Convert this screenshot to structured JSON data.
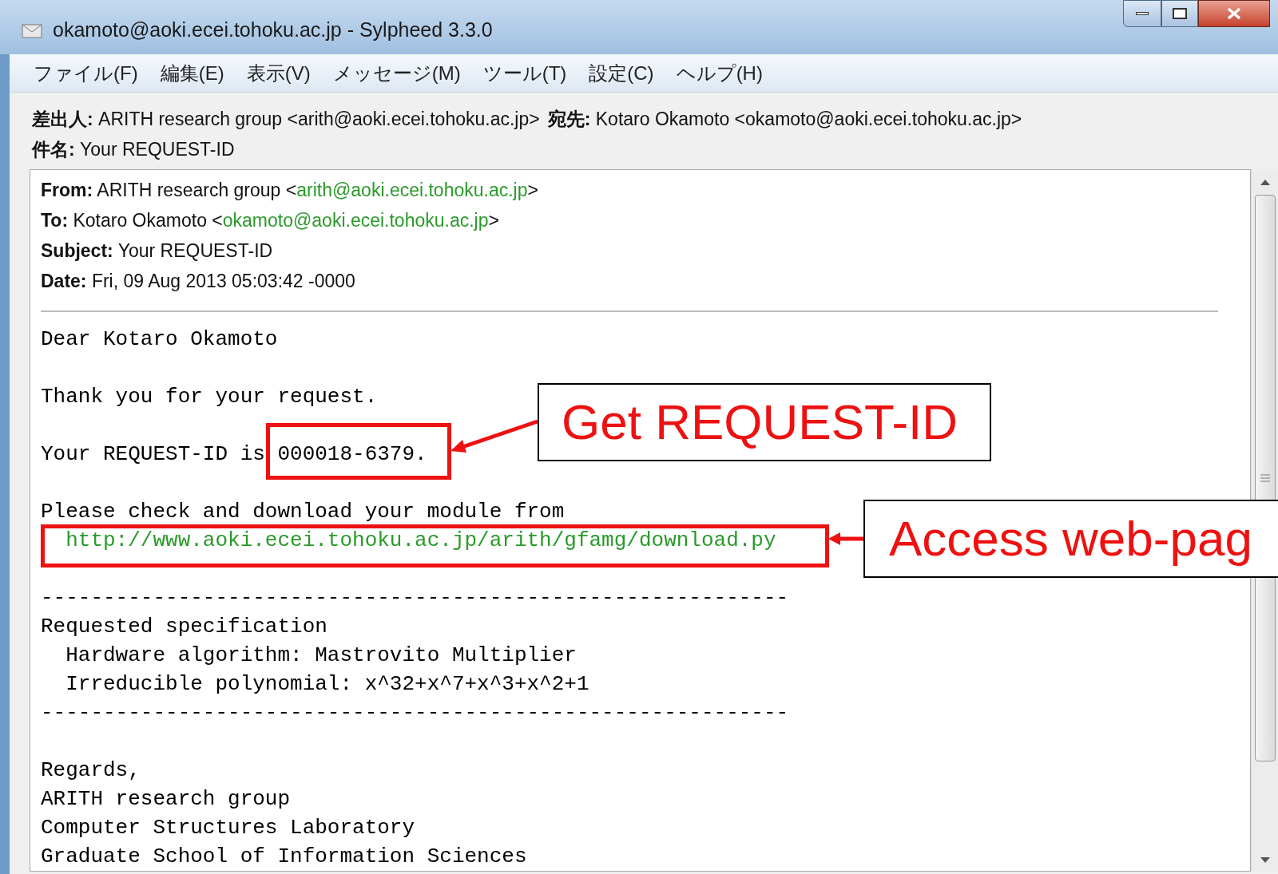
{
  "window": {
    "title": "okamoto@aoki.ecei.tohoku.ac.jp - Sylpheed 3.3.0"
  },
  "menu": [
    "ファイル(F)",
    "編集(E)",
    "表示(V)",
    "メッセージ(M)",
    "ツール(T)",
    "設定(C)",
    "ヘルプ(H)"
  ],
  "summary_header": [
    [
      {
        "label": "差出人:",
        "value": "ARITH research group <arith@aoki.ecei.tohoku.ac.jp>"
      },
      {
        "label": "宛先:",
        "value": "Kotaro Okamoto <okamoto@aoki.ecei.tohoku.ac.jp>"
      }
    ],
    [
      {
        "label": "件名:",
        "value": "Your REQUEST-ID"
      }
    ]
  ],
  "message_header": [
    {
      "label": "From:",
      "value": "ARITH research group <",
      "link": "arith@aoki.ecei.tohoku.ac.jp",
      "after": ">"
    },
    {
      "label": "To:",
      "value": "Kotaro Okamoto <",
      "link": "okamoto@aoki.ecei.tohoku.ac.jp",
      "after": ">"
    },
    {
      "label": "Subject:",
      "value": "Your REQUEST-ID"
    },
    {
      "label": "Date:",
      "value": "Fri, 09 Aug 2013 05:03:42 -0000"
    }
  ],
  "body": [
    [
      {
        "text": "Dear Kotaro Okamoto"
      }
    ],
    [
      {
        "text": "Thank you for your request."
      }
    ],
    [
      {
        "text": "Your REQUEST-ID is 000018-6379."
      }
    ],
    [
      {
        "text": "Please check and download your module from"
      },
      {
        "text": "  http://www.aoki.ecei.tohoku.ac.jp/arith/gfamg/download.py",
        "kind": "link"
      }
    ],
    [
      {
        "text": "------------------------------------------------------------"
      },
      {
        "text": "Requested specification"
      },
      {
        "text": "  Hardware algorithm: Mastrovito Multiplier"
      },
      {
        "text": "  Irreducible polynomial: x^32+x^7+x^3+x^2+1"
      },
      {
        "text": "------------------------------------------------------------"
      }
    ],
    [
      {
        "text": "Regards,"
      },
      {
        "text": "ARITH research group"
      },
      {
        "text": "Computer Structures Laboratory"
      },
      {
        "text": "Graduate School of Information Sciences"
      }
    ]
  ],
  "annotations": [
    {
      "text": "Get REQUEST-ID"
    },
    {
      "text": "Access web-pag"
    }
  ]
}
